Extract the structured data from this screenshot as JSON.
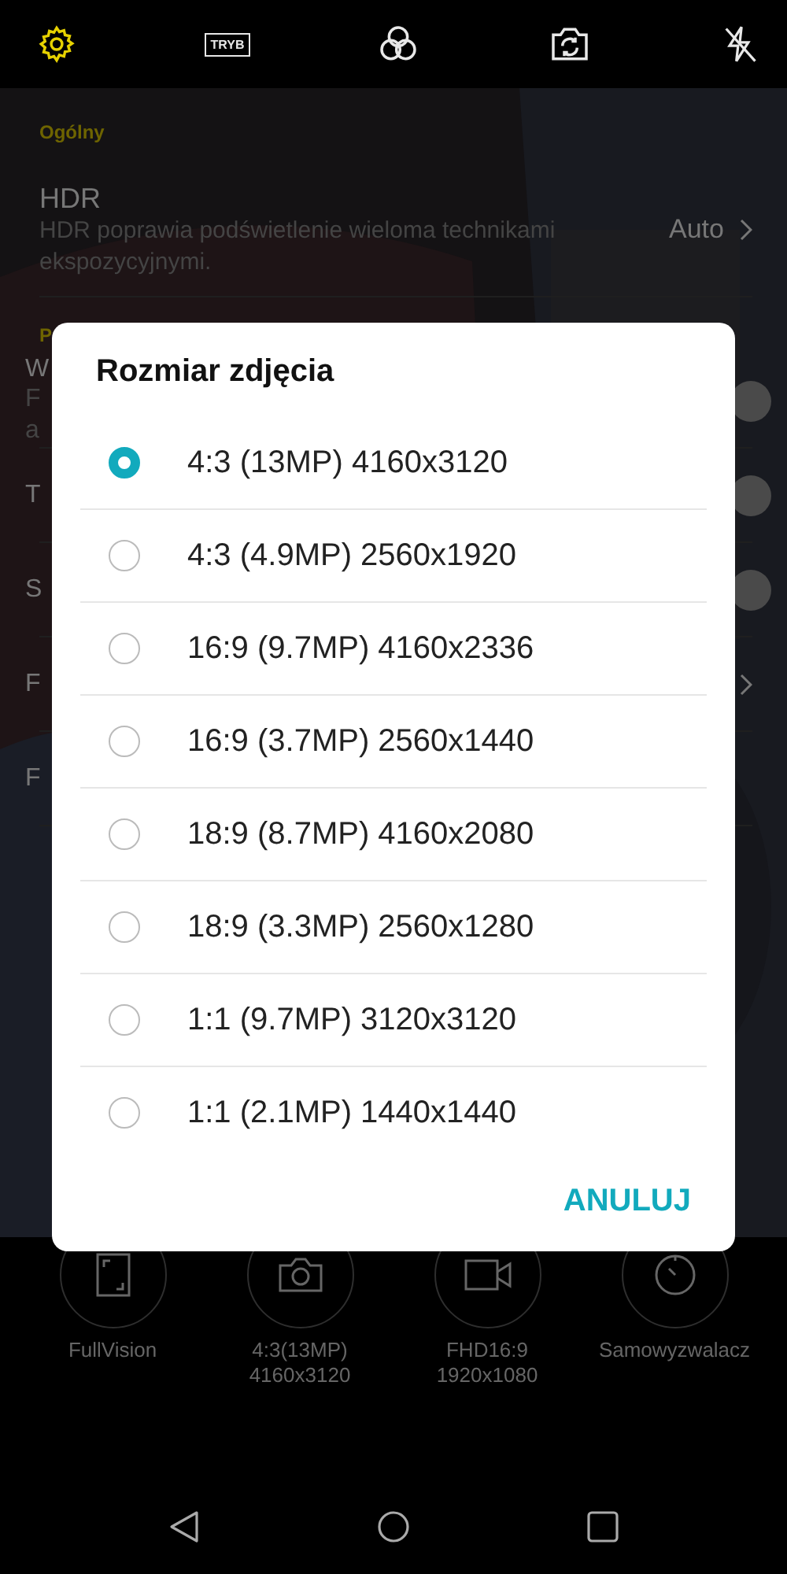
{
  "top_bar": [
    {
      "kind": "settings",
      "selected": true
    },
    {
      "kind": "mode",
      "label": "TRYB",
      "selected": false
    },
    {
      "kind": "filters",
      "selected": false
    },
    {
      "kind": "switch_camera",
      "selected": false
    },
    {
      "kind": "flash_off",
      "selected": false
    }
  ],
  "settings": {
    "sections": [
      {
        "heading": "Ogólny",
        "rows": [
          {
            "kind": "link",
            "title": "HDR",
            "subtitle": "HDR poprawia podświetlenie wieloma technikami ekspozycyjnymi.",
            "value": "Auto"
          }
        ]
      },
      {
        "heading": "P",
        "rows": [
          {
            "kind": "toggle",
            "title": "W",
            "subtitle": "F\na"
          },
          {
            "kind": "toggle",
            "title": "T"
          },
          {
            "kind": "toggle",
            "title": "S"
          },
          {
            "kind": "link",
            "title": "F"
          },
          {
            "kind": "plain",
            "title": "F"
          }
        ]
      }
    ]
  },
  "dialog": {
    "title": "Rozmiar zdjęcia",
    "options": [
      {
        "label": "4:3 (13MP) 4160x3120",
        "selected": true
      },
      {
        "label": "4:3 (4.9MP) 2560x1920",
        "selected": false
      },
      {
        "label": "16:9 (9.7MP) 4160x2336",
        "selected": false
      },
      {
        "label": "16:9 (3.7MP) 2560x1440",
        "selected": false
      },
      {
        "label": "18:9 (8.7MP) 4160x2080",
        "selected": false
      },
      {
        "label": "18:9 (3.3MP) 2560x1280",
        "selected": false
      },
      {
        "label": "1:1 (9.7MP) 3120x3120",
        "selected": false
      },
      {
        "label": "1:1 (2.1MP) 1440x1440",
        "selected": false
      }
    ],
    "cancel": "ANULUJ"
  },
  "quick_modes": [
    {
      "kind": "fullvision",
      "label": "FullVision"
    },
    {
      "label": "4:3(13MP)\n4160x3120"
    },
    {
      "kind": "video",
      "label": "FHD16:9\n1920x1080"
    },
    {
      "kind": "timer",
      "label": "Samowyzwalacz"
    }
  ],
  "nav_bar": [
    {
      "kind": "back"
    },
    {
      "kind": "home"
    },
    {
      "kind": "recents"
    }
  ]
}
